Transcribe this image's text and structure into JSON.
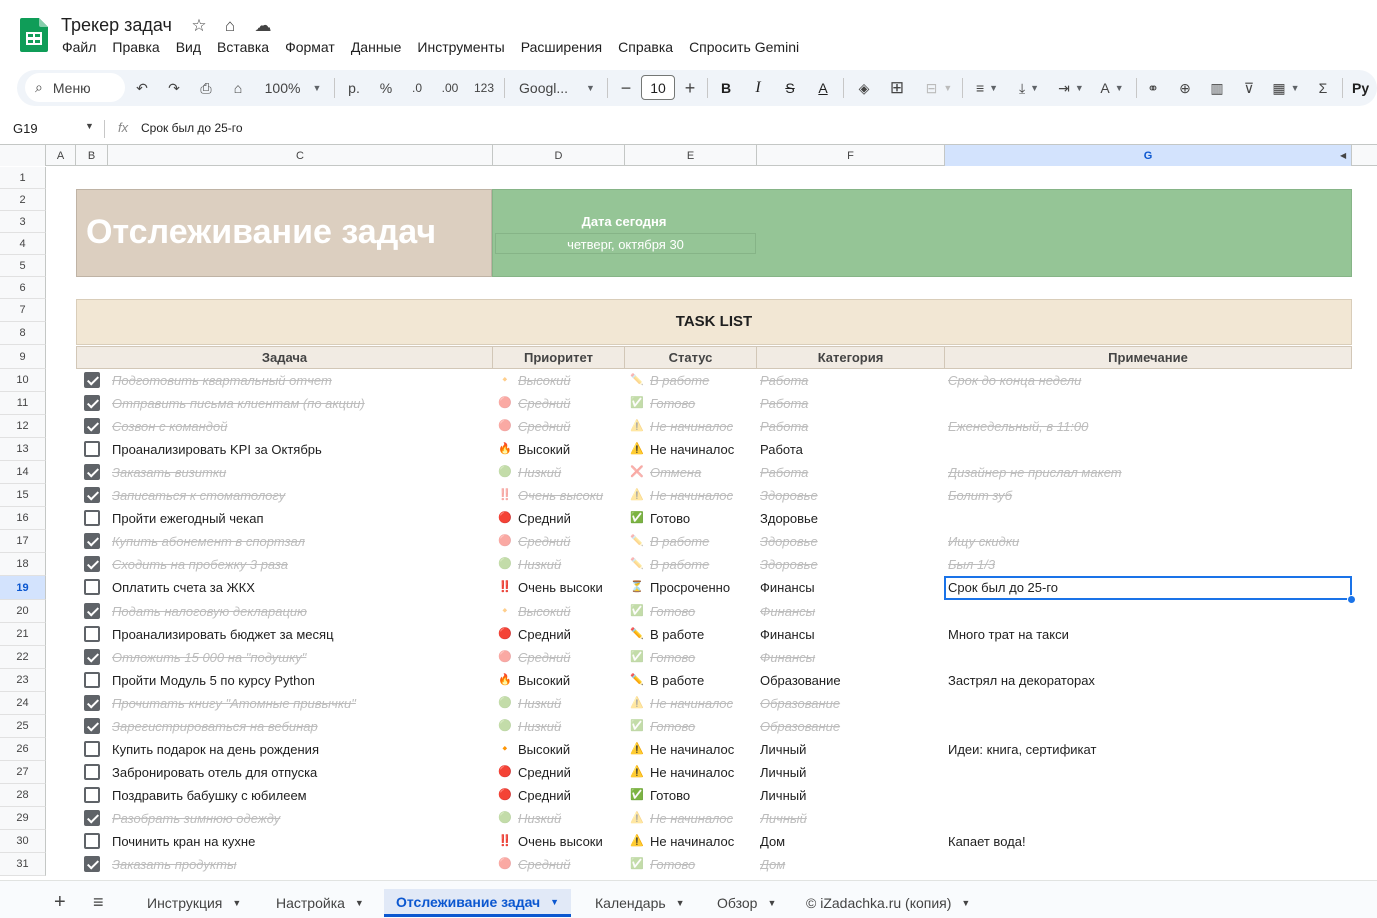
{
  "app": {
    "title": "Трекер задач"
  },
  "menu": [
    "Файл",
    "Правка",
    "Вид",
    "Вставка",
    "Формат",
    "Данные",
    "Инструменты",
    "Расширения",
    "Справка",
    "Спросить Gemini"
  ],
  "toolbar": {
    "menu_search": "Меню",
    "zoom": "100%",
    "currency": "р.",
    "percent": "%",
    "dec_decrease": ".0",
    "dec_increase": ".00",
    "number_format": "123",
    "font": "Googl...",
    "font_size": "10",
    "right_cut": "Py"
  },
  "formula_bar": {
    "cell": "G19",
    "formula": "Срок был до 25-го"
  },
  "columns": [
    "A",
    "B",
    "C",
    "D",
    "E",
    "F",
    "G"
  ],
  "banner": {
    "title": "Отслеживание задач",
    "date_label": "Дата сегодня",
    "date_value": "четверг, октября 30"
  },
  "task_list": {
    "title": "TASK LIST",
    "headers": {
      "task": "Задача",
      "priority": "Приоритет",
      "status": "Статус",
      "category": "Категория",
      "note": "Примечание"
    },
    "rows": [
      {
        "row": "10",
        "done": true,
        "task": "Подготовить квартальный отчет",
        "p_icon": "🔸",
        "priority": "Высокий",
        "s_icon": "✏️",
        "status": "В работе",
        "category": "Работа",
        "note": "Срок до конца недели"
      },
      {
        "row": "11",
        "done": true,
        "task": "Отправить письма клиентам (по акции)",
        "p_icon": "🔴",
        "priority": "Средний",
        "s_icon": "✅",
        "status": "Готово",
        "category": "Работа",
        "note": ""
      },
      {
        "row": "12",
        "done": true,
        "task": "Созвон с командой",
        "p_icon": "🔴",
        "priority": "Средний",
        "s_icon": "⚠️",
        "status": "Не начиналос",
        "category": "Работа",
        "note": "Еженедельный, в 11:00"
      },
      {
        "row": "13",
        "done": false,
        "task": "Проанализировать KPI за Октябрь",
        "p_icon": "🔥",
        "priority": "Высокий",
        "s_icon": "⚠️",
        "status": "Не начиналос",
        "category": "Работа",
        "note": ""
      },
      {
        "row": "14",
        "done": true,
        "task": "Заказать визитки",
        "p_icon": "🟢",
        "priority": "Низкий",
        "s_icon": "❌",
        "status": "Отмена",
        "category": "Работа",
        "note": "Дизайнер не прислал макет"
      },
      {
        "row": "15",
        "done": true,
        "task": "Записаться к стоматологу",
        "p_icon": "‼️",
        "priority": "Очень высоки",
        "s_icon": "⚠️",
        "status": "Не начиналос",
        "category": "Здоровье",
        "note": "Болит зуб"
      },
      {
        "row": "16",
        "done": false,
        "task": "Пройти ежегодный чекап",
        "p_icon": "🔴",
        "priority": "Средний",
        "s_icon": "✅",
        "status": "Готово",
        "category": "Здоровье",
        "note": ""
      },
      {
        "row": "17",
        "done": true,
        "task": "Купить абонемент в спортзал",
        "p_icon": "🔴",
        "priority": "Средний",
        "s_icon": "✏️",
        "status": "В работе",
        "category": "Здоровье",
        "note": "Ищу скидки"
      },
      {
        "row": "18",
        "done": true,
        "task": "Сходить на пробежку 3 раза",
        "p_icon": "🟢",
        "priority": "Низкий",
        "s_icon": "✏️",
        "status": "В работе",
        "category": "Здоровье",
        "note": "Был 1/3"
      },
      {
        "row": "19",
        "done": false,
        "task": "Оплатить счета за ЖКХ",
        "p_icon": "‼️",
        "priority": "Очень высоки",
        "s_icon": "⏳",
        "status": "Просроченно",
        "category": "Финансы",
        "note": "Срок был до 25-го"
      },
      {
        "row": "20",
        "done": true,
        "task": "Подать налоговую декларацию",
        "p_icon": "🔸",
        "priority": "Высокий",
        "s_icon": "✅",
        "status": "Готово",
        "category": "Финансы",
        "note": ""
      },
      {
        "row": "21",
        "done": false,
        "task": "Проанализировать бюджет за месяц",
        "p_icon": "🔴",
        "priority": "Средний",
        "s_icon": "✏️",
        "status": "В работе",
        "category": "Финансы",
        "note": "Много трат на такси"
      },
      {
        "row": "22",
        "done": true,
        "task": "Отложить 15 000 на \"подушку\"",
        "p_icon": "🔴",
        "priority": "Средний",
        "s_icon": "✅",
        "status": "Готово",
        "category": "Финансы",
        "note": ""
      },
      {
        "row": "23",
        "done": false,
        "task": "Пройти Модуль 5 по курсу Python",
        "p_icon": "🔥",
        "priority": "Высокий",
        "s_icon": "✏️",
        "status": "В работе",
        "category": "Образование",
        "note": "Застрял на декораторах"
      },
      {
        "row": "24",
        "done": true,
        "task": "Прочитать книгу \"Атомные привычки\"",
        "p_icon": "🟢",
        "priority": "Низкий",
        "s_icon": "⚠️",
        "status": "Не начиналос",
        "category": "Образование",
        "note": ""
      },
      {
        "row": "25",
        "done": true,
        "task": "Зарегистрироваться на вебинар",
        "p_icon": "🟢",
        "priority": "Низкий",
        "s_icon": "✅",
        "status": "Готово",
        "category": "Образование",
        "note": ""
      },
      {
        "row": "26",
        "done": false,
        "task": "Купить подарок на день рождения",
        "p_icon": "🔸",
        "priority": "Высокий",
        "s_icon": "⚠️",
        "status": "Не начиналос",
        "category": "Личный",
        "note": "Идеи: книга, сертификат"
      },
      {
        "row": "27",
        "done": false,
        "task": "Забронировать отель для отпуска",
        "p_icon": "🔴",
        "priority": "Средний",
        "s_icon": "⚠️",
        "status": "Не начиналос",
        "category": "Личный",
        "note": ""
      },
      {
        "row": "28",
        "done": false,
        "task": "Поздравить бабушку с юбилеем",
        "p_icon": "🔴",
        "priority": "Средний",
        "s_icon": "✅",
        "status": "Готово",
        "category": "Личный",
        "note": ""
      },
      {
        "row": "29",
        "done": true,
        "task": "Разобрать зимнюю одежду",
        "p_icon": "🟢",
        "priority": "Низкий",
        "s_icon": "⚠️",
        "status": "Не начиналос",
        "category": "Личный",
        "note": ""
      },
      {
        "row": "30",
        "done": false,
        "task": "Починить кран на кухне",
        "p_icon": "‼️",
        "priority": "Очень высоки",
        "s_icon": "⚠️",
        "status": "Не начиналос",
        "category": "Дом",
        "note": "Капает вода!"
      },
      {
        "row": "31",
        "done": true,
        "task": "Заказать продукты",
        "p_icon": "🔴",
        "priority": "Средний",
        "s_icon": "✅",
        "status": "Готово",
        "category": "Дом",
        "note": ""
      }
    ]
  },
  "empty_rows": [
    "1",
    "2",
    "3",
    "4",
    "5",
    "6",
    "7",
    "8",
    "9"
  ],
  "sheet_tabs": [
    "Инструкция",
    "Настройка",
    "Отслеживание задач",
    "Календарь",
    "Обзор",
    "© iZadachka.ru (копия)"
  ],
  "active_tab": "Отслеживание задач"
}
